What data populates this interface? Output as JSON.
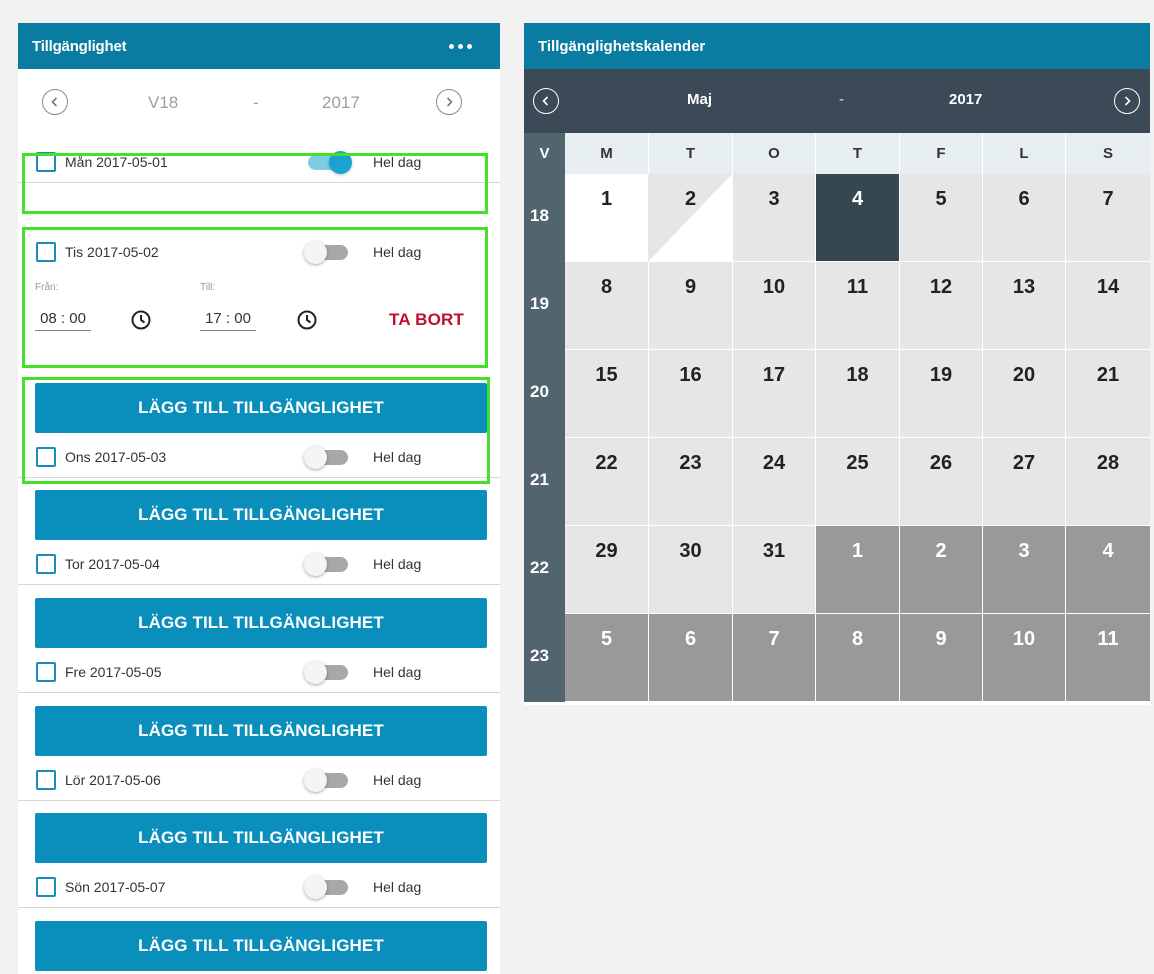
{
  "left_panel": {
    "title": "Tillgänglighet",
    "week_nav": {
      "week": "V18",
      "separator": "-",
      "year": "2017"
    },
    "days": [
      {
        "label": "Mån 2017-05-01",
        "whole_day_label": "Hel dag",
        "whole_day": true
      },
      {
        "label": "Tis 2017-05-02",
        "whole_day_label": "Hel dag",
        "whole_day": false,
        "from_caption": "Från:",
        "from_value": "08 : 00",
        "to_caption": "Till:",
        "to_value": "17 : 00",
        "remove_label": "TA BORT"
      },
      {
        "label": "Ons 2017-05-03",
        "whole_day_label": "Hel dag",
        "whole_day": false
      },
      {
        "label": "Tor 2017-05-04",
        "whole_day_label": "Hel dag",
        "whole_day": false
      },
      {
        "label": "Fre 2017-05-05",
        "whole_day_label": "Hel dag",
        "whole_day": false
      },
      {
        "label": "Lör 2017-05-06",
        "whole_day_label": "Hel dag",
        "whole_day": false
      },
      {
        "label": "Sön 2017-05-07",
        "whole_day_label": "Hel dag",
        "whole_day": false
      }
    ],
    "add_button_label": "LÄGG TILL TILLGÄNGLIGHET"
  },
  "calendar": {
    "title": "Tillgänglighetskalender",
    "month": "Maj",
    "separator": "-",
    "year": "2017",
    "week_col_label": "V",
    "weekdays": [
      "M",
      "T",
      "O",
      "T",
      "F",
      "L",
      "S"
    ],
    "weeks": [
      {
        "num": "18",
        "days": [
          "1",
          "2",
          "3",
          "4",
          "5",
          "6",
          "7"
        ]
      },
      {
        "num": "19",
        "days": [
          "8",
          "9",
          "10",
          "11",
          "12",
          "13",
          "14"
        ]
      },
      {
        "num": "20",
        "days": [
          "15",
          "16",
          "17",
          "18",
          "19",
          "20",
          "21"
        ]
      },
      {
        "num": "21",
        "days": [
          "22",
          "23",
          "24",
          "25",
          "26",
          "27",
          "28"
        ]
      },
      {
        "num": "22",
        "days": [
          "29",
          "30",
          "31",
          "1",
          "2",
          "3",
          "4"
        ]
      },
      {
        "num": "23",
        "days": [
          "5",
          "6",
          "7",
          "8",
          "9",
          "10",
          "11"
        ]
      }
    ]
  },
  "colors": {
    "header": "#0a7ca2",
    "button": "#0a8fbd",
    "remove": "#c0102f",
    "highlight": "#44e02a",
    "today": "#37474f",
    "other_month": "#999999"
  }
}
